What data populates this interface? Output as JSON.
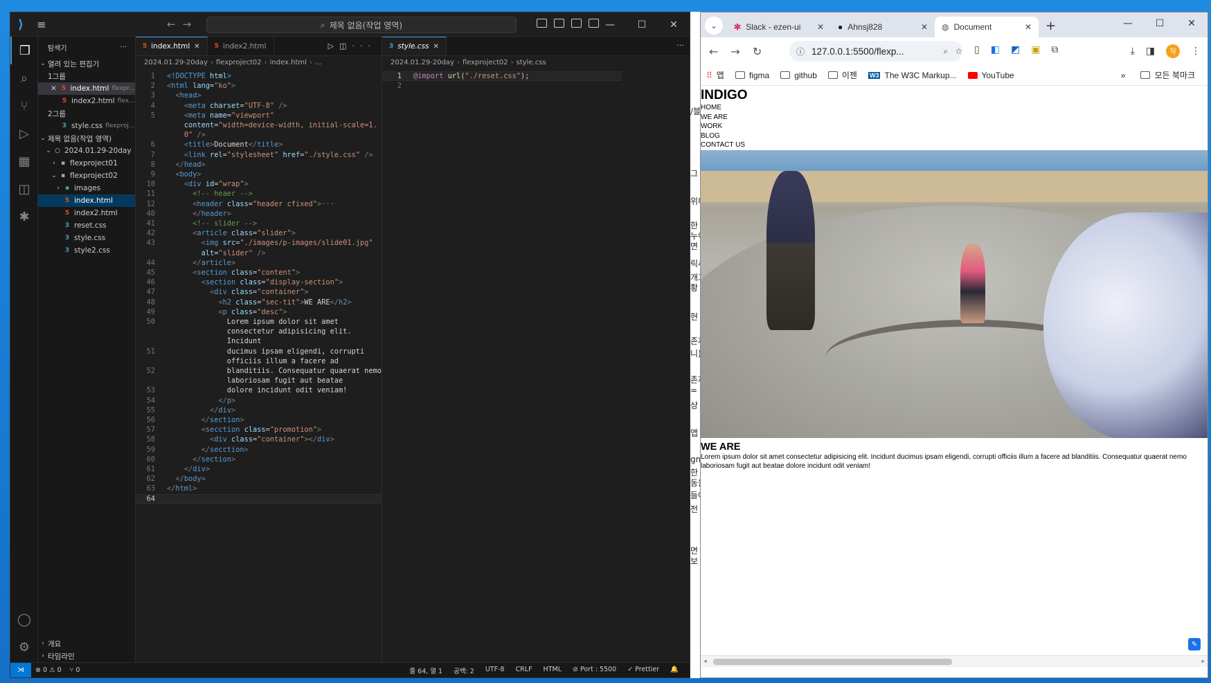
{
  "vscode": {
    "search_placeholder": "제목 없음(작업 영역)",
    "explorer_title": "탐색기",
    "explorer_menu": "···",
    "open_editors_label": "열려 있는 편집기",
    "group1_label": "1그룹",
    "group2_label": "2그룹",
    "open_files": [
      {
        "name": "index.html",
        "hint": "flexpr..."
      },
      {
        "name": "index2.html",
        "hint": "flex..."
      },
      {
        "name": "style.css",
        "hint": "flexproj..."
      }
    ],
    "workspace_label": "제목 없음(작업 영역)",
    "tree": [
      {
        "name": "2024.01.29-20day"
      },
      {
        "name": "flexproject01"
      },
      {
        "name": "flexproject02"
      },
      {
        "name": "images"
      },
      {
        "name": "index.html"
      },
      {
        "name": "index2.html"
      },
      {
        "name": "reset.css"
      },
      {
        "name": "style.css"
      },
      {
        "name": "style2.css"
      }
    ],
    "outline_label": "개요",
    "timeline_label": "타임라인",
    "editor1_tabs": [
      "index.html",
      "index2.html"
    ],
    "editor2_tab": "style.css",
    "breadcrumb1": [
      "2024.01.29-20day",
      "flexproject02",
      "index.html",
      "..."
    ],
    "breadcrumb2": [
      "2024.01.29-20day",
      "flexproject02",
      "style.css"
    ],
    "code_lines": [
      {
        "n": "1",
        "html": "<span class='t'>&lt;!DOCTYPE</span> <span class='a'>html</span><span class='t'>&gt;</span>"
      },
      {
        "n": "2",
        "html": "<span class='p'>&lt;</span><span class='t'>html</span> <span class='a'>lang</span>=<span class='s'>\"ko\"</span><span class='p'>&gt;</span>"
      },
      {
        "n": "3",
        "html": "  <span class='p'>&lt;</span><span class='t'>head</span><span class='p'>&gt;</span>"
      },
      {
        "n": "4",
        "html": "    <span class='p'>&lt;</span><span class='t'>meta</span> <span class='a'>charset</span>=<span class='s'>\"UTF-8\"</span> <span class='p'>/&gt;</span>"
      },
      {
        "n": "5",
        "html": "    <span class='p'>&lt;</span><span class='t'>meta</span> <span class='a'>name</span>=<span class='s'>\"viewport\"</span>"
      },
      {
        "n": "",
        "html": "    <span class='a'>content</span>=<span class='s'>\"width=device-width, initial-scale=1.</span>"
      },
      {
        "n": "",
        "html": "    <span class='s'>0\"</span> <span class='p'>/&gt;</span>"
      },
      {
        "n": "6",
        "html": "    <span class='p'>&lt;</span><span class='t'>title</span><span class='p'>&gt;</span><span class='tx'>Document</span><span class='p'>&lt;/</span><span class='t'>title</span><span class='p'>&gt;</span>"
      },
      {
        "n": "7",
        "html": "    <span class='p'>&lt;</span><span class='t'>link</span> <span class='a'>rel</span>=<span class='s'>\"stylesheet\"</span> <span class='a'>href</span>=<span class='s'>\"./style.css\"</span> <span class='p'>/&gt;</span>"
      },
      {
        "n": "8",
        "html": "  <span class='p'>&lt;/</span><span class='t'>head</span><span class='p'>&gt;</span>"
      },
      {
        "n": "9",
        "html": "  <span class='p'>&lt;</span><span class='t'>body</span><span class='p'>&gt;</span>"
      },
      {
        "n": "10",
        "html": "    <span class='p'>&lt;</span><span class='t'>div</span> <span class='a'>id</span>=<span class='s'>\"wrap\"</span><span class='p'>&gt;</span>"
      },
      {
        "n": "11",
        "html": "      <span class='c'>&lt;!-- heaer --&gt;</span>"
      },
      {
        "n": "12",
        "html": "      <span class='p'>&lt;</span><span class='t'>header</span> <span class='a'>class</span>=<span class='s'>\"header cfixed\"</span><span class='p'>&gt;</span><span class='p'>···</span>"
      },
      {
        "n": "40",
        "html": "      <span class='p'>&lt;/</span><span class='t'>header</span><span class='p'>&gt;</span>"
      },
      {
        "n": "41",
        "html": "      <span class='c'>&lt;!-- slider --&gt;</span>"
      },
      {
        "n": "42",
        "html": "      <span class='p'>&lt;</span><span class='t'>article</span> <span class='a'>class</span>=<span class='s'>\"slider\"</span><span class='p'>&gt;</span>"
      },
      {
        "n": "43",
        "html": "        <span class='p'>&lt;</span><span class='t'>img</span> <span class='a'>src</span>=<span class='s'>\"./images/p-images/slide01.jpg\"</span>"
      },
      {
        "n": "",
        "html": "        <span class='a'>alt</span>=<span class='s'>\"slider\"</span> <span class='p'>/&gt;</span>"
      },
      {
        "n": "44",
        "html": "      <span class='p'>&lt;/</span><span class='t'>article</span><span class='p'>&gt;</span>"
      },
      {
        "n": "45",
        "html": "      <span class='p'>&lt;</span><span class='t'>section</span> <span class='a'>class</span>=<span class='s'>\"content\"</span><span class='p'>&gt;</span>"
      },
      {
        "n": "46",
        "html": "        <span class='p'>&lt;</span><span class='t'>section</span> <span class='a'>class</span>=<span class='s'>\"display-section\"</span><span class='p'>&gt;</span>"
      },
      {
        "n": "47",
        "html": "          <span class='p'>&lt;</span><span class='t'>div</span> <span class='a'>class</span>=<span class='s'>\"container\"</span><span class='p'>&gt;</span>"
      },
      {
        "n": "48",
        "html": "            <span class='p'>&lt;</span><span class='t'>h2</span> <span class='a'>class</span>=<span class='s'>\"sec-tit\"</span><span class='p'>&gt;</span><span class='tx'>WE ARE</span><span class='p'>&lt;/</span><span class='t'>h2</span><span class='p'>&gt;</span>"
      },
      {
        "n": "49",
        "html": "            <span class='p'>&lt;</span><span class='t'>p</span> <span class='a'>class</span>=<span class='s'>\"desc\"</span><span class='p'>&gt;</span>"
      },
      {
        "n": "50",
        "html": "              <span class='tx'>Lorem ipsum dolor sit amet</span>"
      },
      {
        "n": "",
        "html": "              <span class='tx'>consectetur adipisicing elit.</span>"
      },
      {
        "n": "",
        "html": "              <span class='tx'>Incidunt</span>"
      },
      {
        "n": "51",
        "html": "              <span class='tx'>ducimus ipsam eligendi, corrupti</span>"
      },
      {
        "n": "",
        "html": "              <span class='tx'>officiis illum a facere ad</span>"
      },
      {
        "n": "52",
        "html": "              <span class='tx'>blanditiis. Consequatur quaerat nemo</span>"
      },
      {
        "n": "",
        "html": "              <span class='tx'>laboriosam fugit aut beatae</span>"
      },
      {
        "n": "53",
        "html": "              <span class='tx'>dolore incidunt odit veniam!</span>"
      },
      {
        "n": "54",
        "html": "            <span class='p'>&lt;/</span><span class='t'>p</span><span class='p'>&gt;</span>"
      },
      {
        "n": "55",
        "html": "          <span class='p'>&lt;/</span><span class='t'>div</span><span class='p'>&gt;</span>"
      },
      {
        "n": "56",
        "html": "        <span class='p'>&lt;/</span><span class='t'>section</span><span class='p'>&gt;</span>"
      },
      {
        "n": "57",
        "html": "        <span class='p'>&lt;</span><span class='t'>seccti​on</span> <span class='a'>class</span>=<span class='s'>\"promotion\"</span><span class='p'>&gt;</span>"
      },
      {
        "n": "58",
        "html": "          <span class='p'>&lt;</span><span class='t'>div</span> <span class='a'>class</span>=<span class='s'>\"container\"</span><span class='p'>&gt;&lt;/</span><span class='t'>div</span><span class='p'>&gt;</span>"
      },
      {
        "n": "59",
        "html": "        <span class='p'>&lt;/</span><span class='t'>secction</span><span class='p'>&gt;</span>"
      },
      {
        "n": "60",
        "html": "      <span class='p'>&lt;/</span><span class='t'>section</span><span class='p'>&gt;</span>"
      },
      {
        "n": "61",
        "html": "    <span class='p'>&lt;/</span><span class='t'>div</span><span class='p'>&gt;</span>"
      },
      {
        "n": "62",
        "html": "  <span class='p'>&lt;/</span><span class='t'>body</span><span class='p'>&gt;</span>"
      },
      {
        "n": "63",
        "html": "<span class='p'>&lt;/</span><span class='t'>html</span><span class='p'>&gt;</span>"
      },
      {
        "n": "64",
        "html": ""
      }
    ],
    "css_lines": [
      {
        "n": "1",
        "html": "<span class='at'>@import</span> <span class='f'>url</span>(<span class='s'>\"./reset.css\"</span>);"
      },
      {
        "n": "2",
        "html": ""
      }
    ],
    "status": {
      "errors": "0",
      "warnings": "0",
      "ports": "0",
      "position": "줄 64, 열 1",
      "spaces": "공백: 2",
      "encoding": "UTF-8",
      "eol": "CRLF",
      "language": "HTML",
      "port": "Port : 5500",
      "prettier": "Prettier"
    }
  },
  "chrome": {
    "tabs": [
      "Slack - ezen-ui",
      "Ahnsj828",
      "Document"
    ],
    "url": "127.0.0.1:5500/flexp...",
    "profile_initials": "SJ",
    "bookmarks": [
      "앱",
      "figma",
      "github",
      "이젠",
      "The W3C Markup...",
      "YouTube"
    ],
    "all_bookmarks": "모든 북마크"
  },
  "site": {
    "logo": "INDIGO",
    "nav": [
      "HOME",
      "WE ARE",
      "WORK",
      "BLOG",
      "CONTACT US"
    ],
    "sec_title": "WE ARE",
    "desc": "Lorem ipsum dolor sit amet consectetur adipisicing elit. Incidunt ducimus ipsam eligendi, corrupti officiis illum a facere ad blanditiis. Consequatur quaerat nemo laboriosam fugit aut beatae dolore incidunt odit veniam!"
  },
  "behind_text": [
    "/블",
    "그",
    "위해",
    "한",
    "누이",
    "면",
    "릭세",
    "개고",
    "황",
    "현",
    "존재",
    "니)",
    "존재",
    "=",
    "상",
    "앱",
    "gn",
    "한",
    "동을",
    "들어",
    "전 가",
    "면",
    "보"
  ]
}
